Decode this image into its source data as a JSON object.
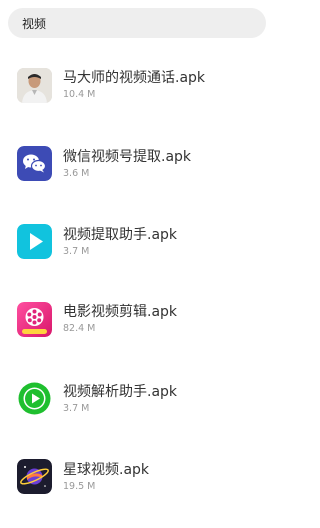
{
  "search": {
    "query": "视频"
  },
  "files": [
    {
      "name": "马大师的视频通话.apk",
      "size": "10.4 M",
      "icon": "user-photo-icon"
    },
    {
      "name": "微信视频号提取.apk",
      "size": "3.6 M",
      "icon": "wechat-icon"
    },
    {
      "name": "视频提取助手.apk",
      "size": "3.7 M",
      "icon": "play-icon"
    },
    {
      "name": "电影视频剪辑.apk",
      "size": "82.4 M",
      "icon": "film-reel-icon"
    },
    {
      "name": "视频解析助手.apk",
      "size": "3.7 M",
      "icon": "play-circle-icon"
    },
    {
      "name": "星球视频.apk",
      "size": "19.5 M",
      "icon": "planet-icon"
    }
  ],
  "colors": {
    "search_bg": "#eeeeee",
    "name_text": "#333333",
    "size_text": "#999999",
    "wechat_bg": "#3d4bb5",
    "play_bg": "#11c3de",
    "film_bg": "#f0287e",
    "play_circle_bg": "#1fbf2f",
    "planet_bg": "#1c1c2e"
  }
}
